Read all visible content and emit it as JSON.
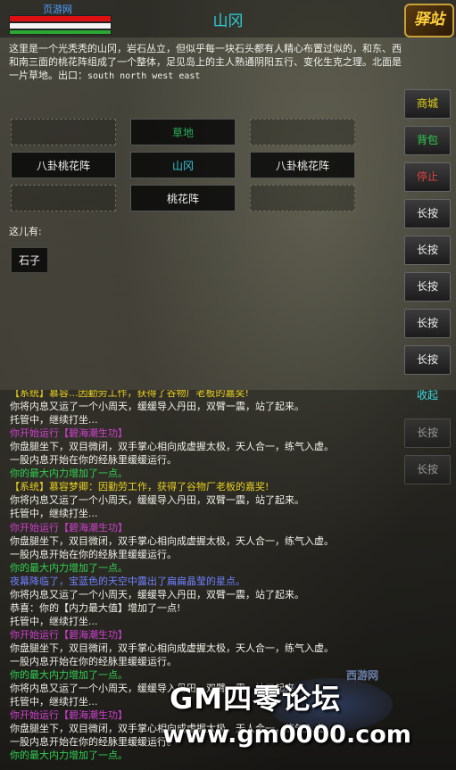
{
  "header": {
    "player_name": "页游网",
    "room_title": "山冈",
    "logo_text": "驿站"
  },
  "stats": {
    "hp_fraction": 1.0,
    "mp_fraction": 1.0,
    "xp_fraction": 0.55
  },
  "description": {
    "text": "这里是一个光秃秃的山冈，岩石丛立，但似乎每一块石头都有人精心布置过似的，和东、西和南三面的桃花阵组成了一个整体，足见岛上的主人熟通阴阳五行、变化生克之理。北面是一片草地。",
    "exits_label": "出口：",
    "exits": "south  north  west  east"
  },
  "map": {
    "north": "草地",
    "west": "八卦桃花阵",
    "current": "山冈",
    "east": "八卦桃花阵",
    "south": "桃花阵"
  },
  "here": {
    "label": "这儿有:",
    "items": [
      "石子"
    ]
  },
  "side_buttons": {
    "shop": "商城",
    "bag": "背包",
    "stop": "停止",
    "long_press_1": "长按",
    "long_press_2": "长按",
    "long_press_3": "长按",
    "long_press_4": "长按",
    "long_press_5": "长按",
    "collapse": "收起",
    "long_press_6": "长按",
    "long_press_7": "长按"
  },
  "log": [
    {
      "text": "【系统】慕容...因勤劳工作，获得了谷物厂老板的嘉奖!",
      "color": "y"
    },
    {
      "text": "你将内息又运了一个小周天，缓缓导入丹田，双臂一震，站了起来。",
      "color": "w"
    },
    {
      "text": "托管中，继续打坐...",
      "color": "w"
    },
    {
      "text": "你开始运行【碧海潮生功】",
      "color": "m"
    },
    {
      "text": "你盘腿坐下，双目微闭，双手掌心相向成虚握太极，天人合一，练气入虚。",
      "color": "w"
    },
    {
      "text": "一股内息开始在你的经脉里缓缓运行。",
      "color": "w"
    },
    {
      "text": "你的最大内力增加了一点。",
      "color": "g"
    },
    {
      "text": "【系统】慕容梦卿：因勤劳工作，获得了谷物厂老板的嘉奖!",
      "color": "y"
    },
    {
      "text": "你将内息又运了一个小周天，缓缓导入丹田，双臂一震，站了起来。",
      "color": "w"
    },
    {
      "text": "托管中，继续打坐...",
      "color": "w"
    },
    {
      "text": "你开始运行【碧海潮生功】",
      "color": "m"
    },
    {
      "text": "你盘腿坐下，双目微闭，双手掌心相向成虚握太极，天人合一，练气入虚。",
      "color": "w"
    },
    {
      "text": "一股内息开始在你的经脉里缓缓运行。",
      "color": "w"
    },
    {
      "text": "你的最大内力增加了一点。",
      "color": "g"
    },
    {
      "text": "夜幕降临了，宝蓝色的天空中露出了扁扁晶莹的星点。",
      "color": "b"
    },
    {
      "text": "你将内息又运了一个小周天，缓缓导入丹田，双臂一震，站了起来。",
      "color": "w"
    },
    {
      "text": "恭喜：你的【内力最大值】增加了一点!",
      "color": "w"
    },
    {
      "text": "托管中，继续打坐...",
      "color": "w"
    },
    {
      "text": "你开始运行【碧海潮生功】",
      "color": "m"
    },
    {
      "text": "你盘腿坐下，双目微闭，双手掌心相向成虚握太极，天人合一，练气入虚。",
      "color": "w"
    },
    {
      "text": "一股内息开始在你的经脉里缓缓运行。",
      "color": "w"
    },
    {
      "text": "你的最大内力增加了一点。",
      "color": "g"
    },
    {
      "text": "你将内息又运了一个小周天，缓缓导入丹田，双臂一震，站了起来。",
      "color": "w"
    },
    {
      "text": "托管中，继续打坐...",
      "color": "w"
    },
    {
      "text": "你开始运行【碧海潮生功】",
      "color": "m"
    },
    {
      "text": "你盘腿坐下，双目微闭，双手掌心相向成虚握太极，天人合一，练气入虚。",
      "color": "w"
    },
    {
      "text": "一股内息开始在你的经脉里缓缓运行。",
      "color": "w"
    },
    {
      "text": "你的最大内力增加了一点。",
      "color": "g"
    }
  ],
  "watermark": {
    "site_small": "西游网",
    "main": "GM四零论坛",
    "url": "www.gm0000.com"
  }
}
